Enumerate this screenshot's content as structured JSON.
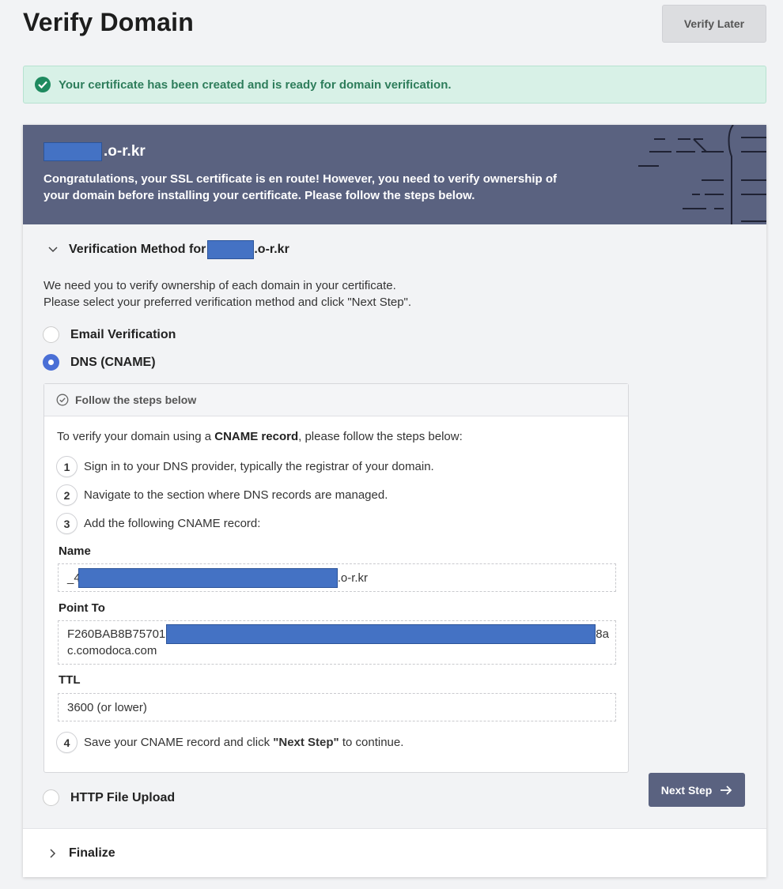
{
  "page": {
    "title": "Verify Domain",
    "verify_later_label": "Verify Later"
  },
  "alert": {
    "message": "Your certificate has been created and is ready for domain verification."
  },
  "card_header": {
    "domain_suffix": ".o-r.kr",
    "message": "Congratulations, your SSL certificate is en route! However, you need to verify ownership of your domain before installing your certificate. Please follow the steps below."
  },
  "verification": {
    "section_label": "Verification Method for",
    "domain_suffix": ".o-r.kr",
    "intro_line1": "We need you to verify ownership of each domain in your certificate.",
    "intro_line2": "Please select your preferred verification method and click \"Next Step\".",
    "methods": [
      {
        "label": "Email Verification",
        "selected": false
      },
      {
        "label": "DNS (CNAME)",
        "selected": true
      },
      {
        "label": "HTTP File Upload",
        "selected": false
      }
    ]
  },
  "steps_box": {
    "header": "Follow the steps below",
    "intro_prefix": "To verify your domain using a ",
    "intro_bold": "CNAME record",
    "intro_suffix": ", please follow the steps below:",
    "steps": [
      {
        "num": "1",
        "text": "Sign in to your DNS provider, typically the registrar of your domain."
      },
      {
        "num": "2",
        "text": "Navigate to the section where DNS records are managed."
      },
      {
        "num": "3",
        "text": "Add the following CNAME record:"
      }
    ],
    "step4": {
      "num": "4",
      "prefix": "Save your CNAME record and click ",
      "bold": "\"Next Step\"",
      "suffix": " to continue."
    },
    "name_label": "Name",
    "name_prefix": "_4",
    "name_suffix": ".o-r.kr",
    "point_to_label": "Point To",
    "point_to_prefix": "F260BAB8B75701",
    "point_to_suffix": "8a",
    "point_to_line2": "c.comodoca.com",
    "ttl_label": "TTL",
    "ttl_value": "3600 (or lower)"
  },
  "next_step_label": "Next Step",
  "finalize_label": "Finalize",
  "colors": {
    "header_bg": "#5a6280",
    "alert_bg": "#d8f1e7",
    "alert_text": "#2e7d5b",
    "radio_selected": "#4a6fd6",
    "redaction": "#4472c4"
  },
  "icons": {
    "alert": "check-circle-icon",
    "section_toggle": "chevron-down-icon",
    "steps_header": "check-circle-outline-icon",
    "next_step": "arrow-right-icon",
    "finalize_toggle": "chevron-right-icon"
  }
}
